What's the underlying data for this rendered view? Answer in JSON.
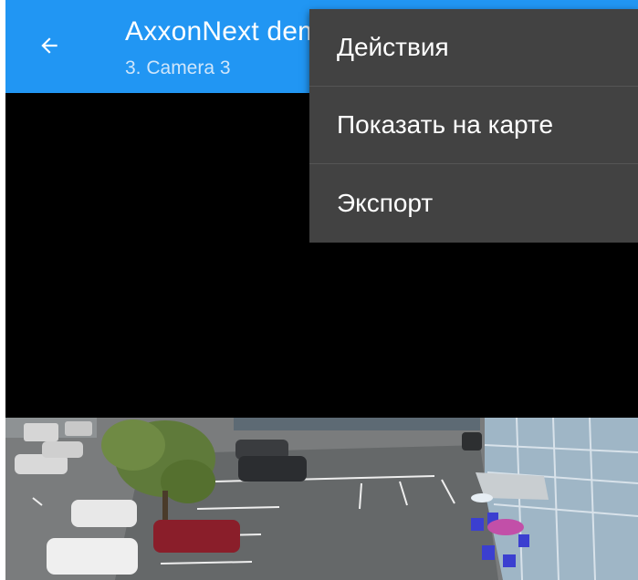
{
  "appbar": {
    "title": "AxxonNext demo",
    "subtitle": "3. Camera 3",
    "back_icon": "arrow-left-icon",
    "color": "#2196f3"
  },
  "menu": {
    "items": [
      {
        "label": "Действия"
      },
      {
        "label": "Показать на карте"
      },
      {
        "label": "Экспорт"
      }
    ],
    "background": "#424242"
  }
}
